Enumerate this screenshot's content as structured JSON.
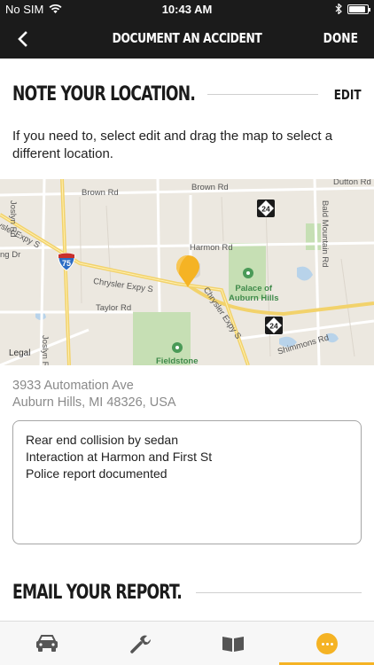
{
  "status": {
    "carrier": "No SIM",
    "time": "10:43 AM"
  },
  "nav": {
    "title": "DOCUMENT AN ACCIDENT",
    "done_label": "DONE"
  },
  "location_section": {
    "title": "NOTE YOUR LOCATION.",
    "edit_label": "EDIT",
    "instructions": "If you need to, select edit and drag the map to select a different location."
  },
  "map": {
    "labels": {
      "brown_rd_1": "Brown Rd",
      "brown_rd_2": "Brown Rd",
      "dutton_rd": "Dutton Rd",
      "joslyn_rd_1": "Joslyn Rd",
      "chrysler_expy_1": "ysler Expy S",
      "lg_dr": "ng Dr",
      "harmon_rd": "Harmon Rd",
      "bald_mountain_rd": "Bald Mountain Rd",
      "chrysler_expy_2": "Chrysler Expy S",
      "chrysler_expy_3": "Chrysler Expy S",
      "palace": "Palace of\nAuburn Hills",
      "taylor_rd": "Taylor Rd",
      "joslyn_rd_2": "Joslyn Rd",
      "fieldstone": "Fieldstone",
      "shimmons_rd": "Shimmons Rd"
    },
    "route_75": "75",
    "route_24_a": "24",
    "route_24_b": "24",
    "legal": "Legal",
    "pin_color": "#f5b324"
  },
  "address": {
    "line1": "3933 Automation Ave",
    "line2": "Auburn Hills, MI 48326, USA"
  },
  "notes": {
    "lines": [
      "Rear end collision by sedan",
      "Interaction at Harmon and First St",
      "Police report documented"
    ]
  },
  "email_section": {
    "title": "EMAIL YOUR REPORT."
  },
  "tabs": [
    {
      "icon": "car-icon"
    },
    {
      "icon": "wrench-icon"
    },
    {
      "icon": "book-icon"
    },
    {
      "icon": "more-icon"
    }
  ],
  "colors": {
    "accent": "#f5b324",
    "header_bg": "#1b1b1b"
  }
}
